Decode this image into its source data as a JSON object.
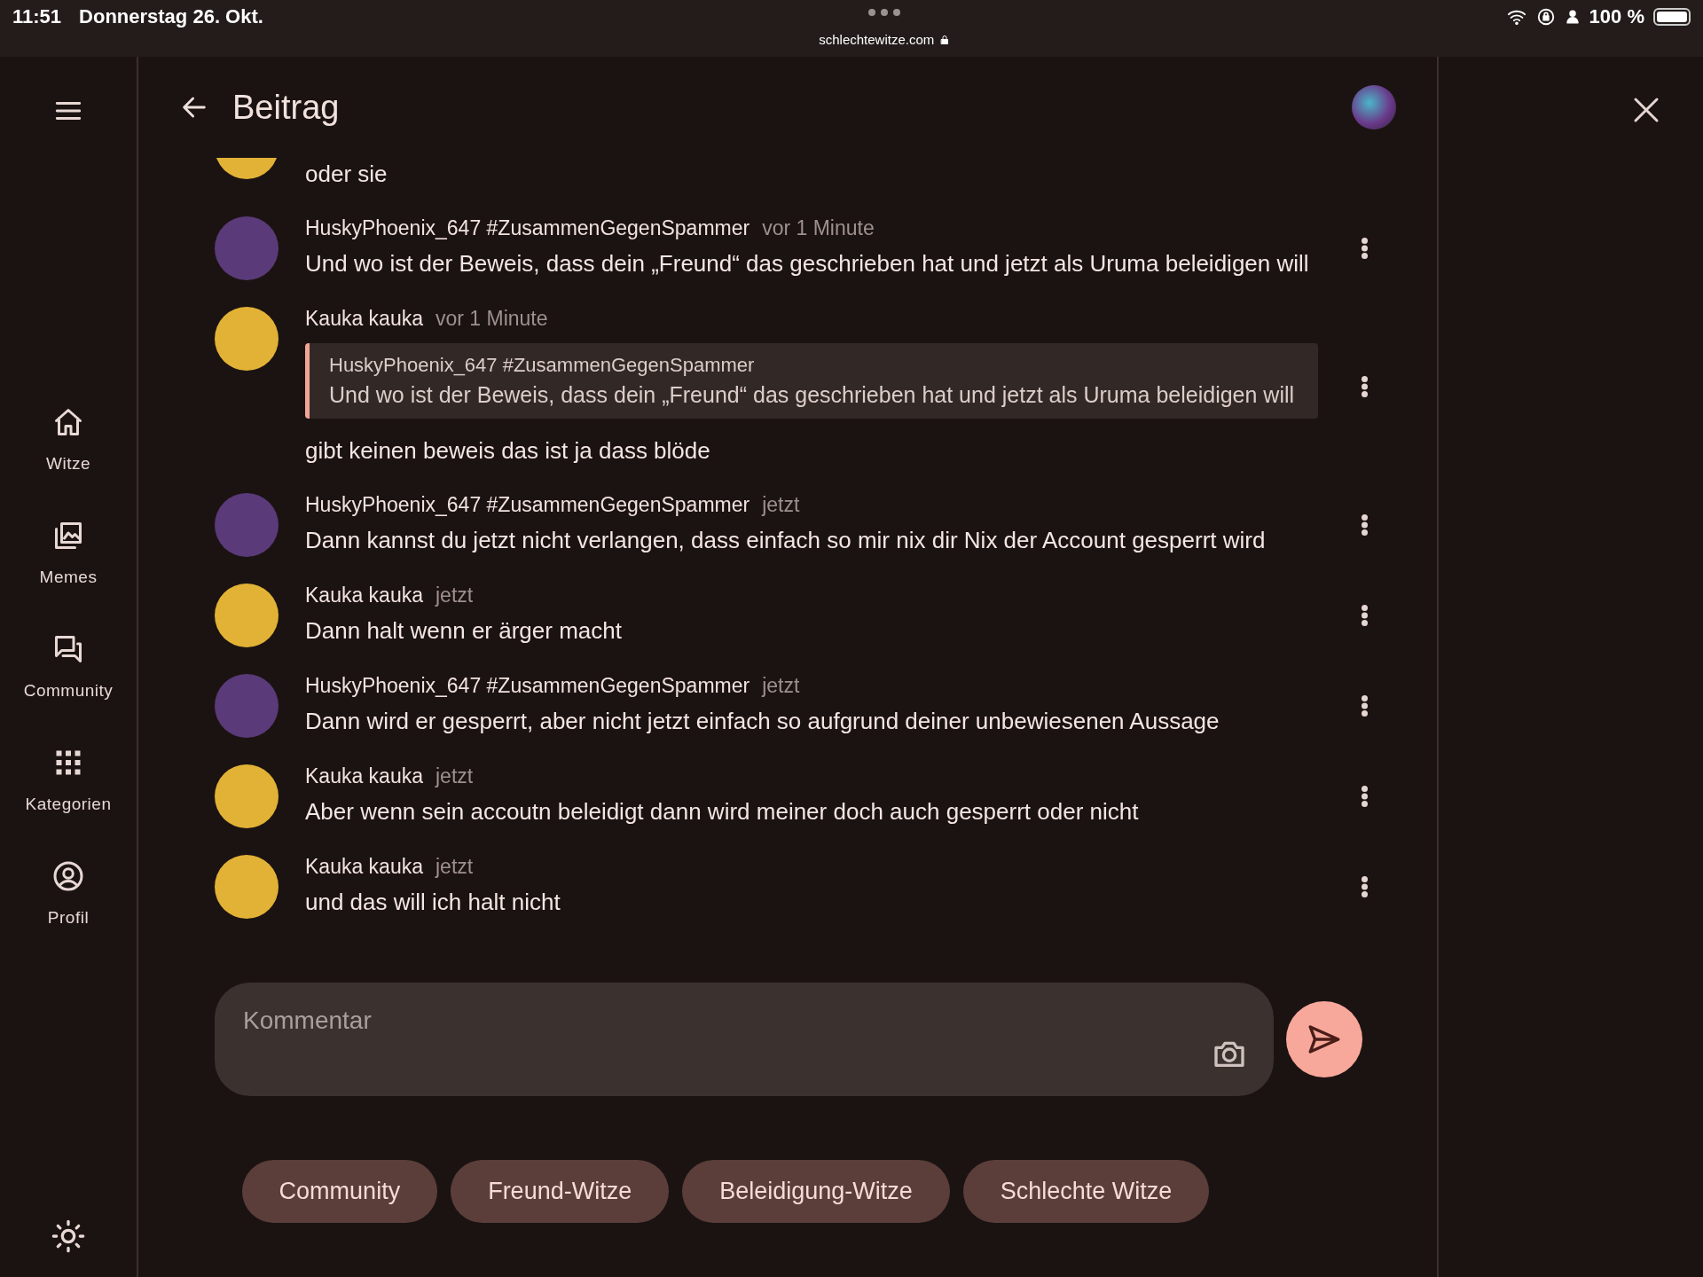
{
  "status_bar": {
    "time": "11:51",
    "date": "Donnerstag 26. Okt.",
    "url": "schlechtewitze.com",
    "battery": "100 %"
  },
  "sidebar": {
    "items": [
      {
        "kind": "home",
        "label": "Witze"
      },
      {
        "kind": "images",
        "label": "Memes"
      },
      {
        "kind": "chat",
        "label": "Community"
      },
      {
        "kind": "grid",
        "label": "Kategorien"
      },
      {
        "kind": "profile",
        "label": "Profil"
      }
    ]
  },
  "header": {
    "title": "Beitrag"
  },
  "comments": [
    {
      "kind": "cut",
      "color": "#e2b236",
      "text": "oder sie"
    },
    {
      "kind": "full",
      "color": "#5a3a78",
      "author": "HuskyPhoenix_647 #ZusammenGegenSpammer",
      "time": "vor 1 Minute",
      "text": "Und wo ist der Beweis, dass dein „Freund“ das geschrieben hat und jetzt als Uruma beleidigen will"
    },
    {
      "kind": "full",
      "color": "#e2b236",
      "author": "Kauka kauka",
      "time": "vor 1 Minute",
      "quote": {
        "author": "HuskyPhoenix_647 #ZusammenGegenSpammer",
        "text": "Und wo ist der Beweis, dass dein „Freund“ das geschrieben hat und jetzt als Uruma beleidigen will"
      },
      "text": "gibt keinen beweis das ist ja dass blöde"
    },
    {
      "kind": "full",
      "color": "#5a3a78",
      "author": "HuskyPhoenix_647 #ZusammenGegenSpammer",
      "time": "jetzt",
      "text": "Dann kannst du jetzt nicht verlangen, dass einfach so mir nix dir Nix der Account gesperrt wird"
    },
    {
      "kind": "full",
      "color": "#e2b236",
      "author": "Kauka kauka",
      "time": "jetzt",
      "text": "Dann halt wenn er ärger macht"
    },
    {
      "kind": "full",
      "color": "#5a3a78",
      "author": "HuskyPhoenix_647 #ZusammenGegenSpammer",
      "time": "jetzt",
      "text": "Dann wird er gesperrt, aber nicht jetzt einfach so aufgrund deiner unbewiesenen Aussage"
    },
    {
      "kind": "full",
      "color": "#e2b236",
      "author": "Kauka kauka",
      "time": "jetzt",
      "text": "Aber wenn sein accoutn beleidigt dann wird meiner doch auch gesperrt oder nicht"
    },
    {
      "kind": "full",
      "color": "#e2b236",
      "author": "Kauka kauka",
      "time": "jetzt",
      "text": "und das will ich halt nicht"
    }
  ],
  "comment_field": {
    "placeholder": "Kommentar"
  },
  "tags": [
    "Community",
    "Freund-Witze",
    "Beleidigung-Witze",
    "Schlechte Witze"
  ]
}
